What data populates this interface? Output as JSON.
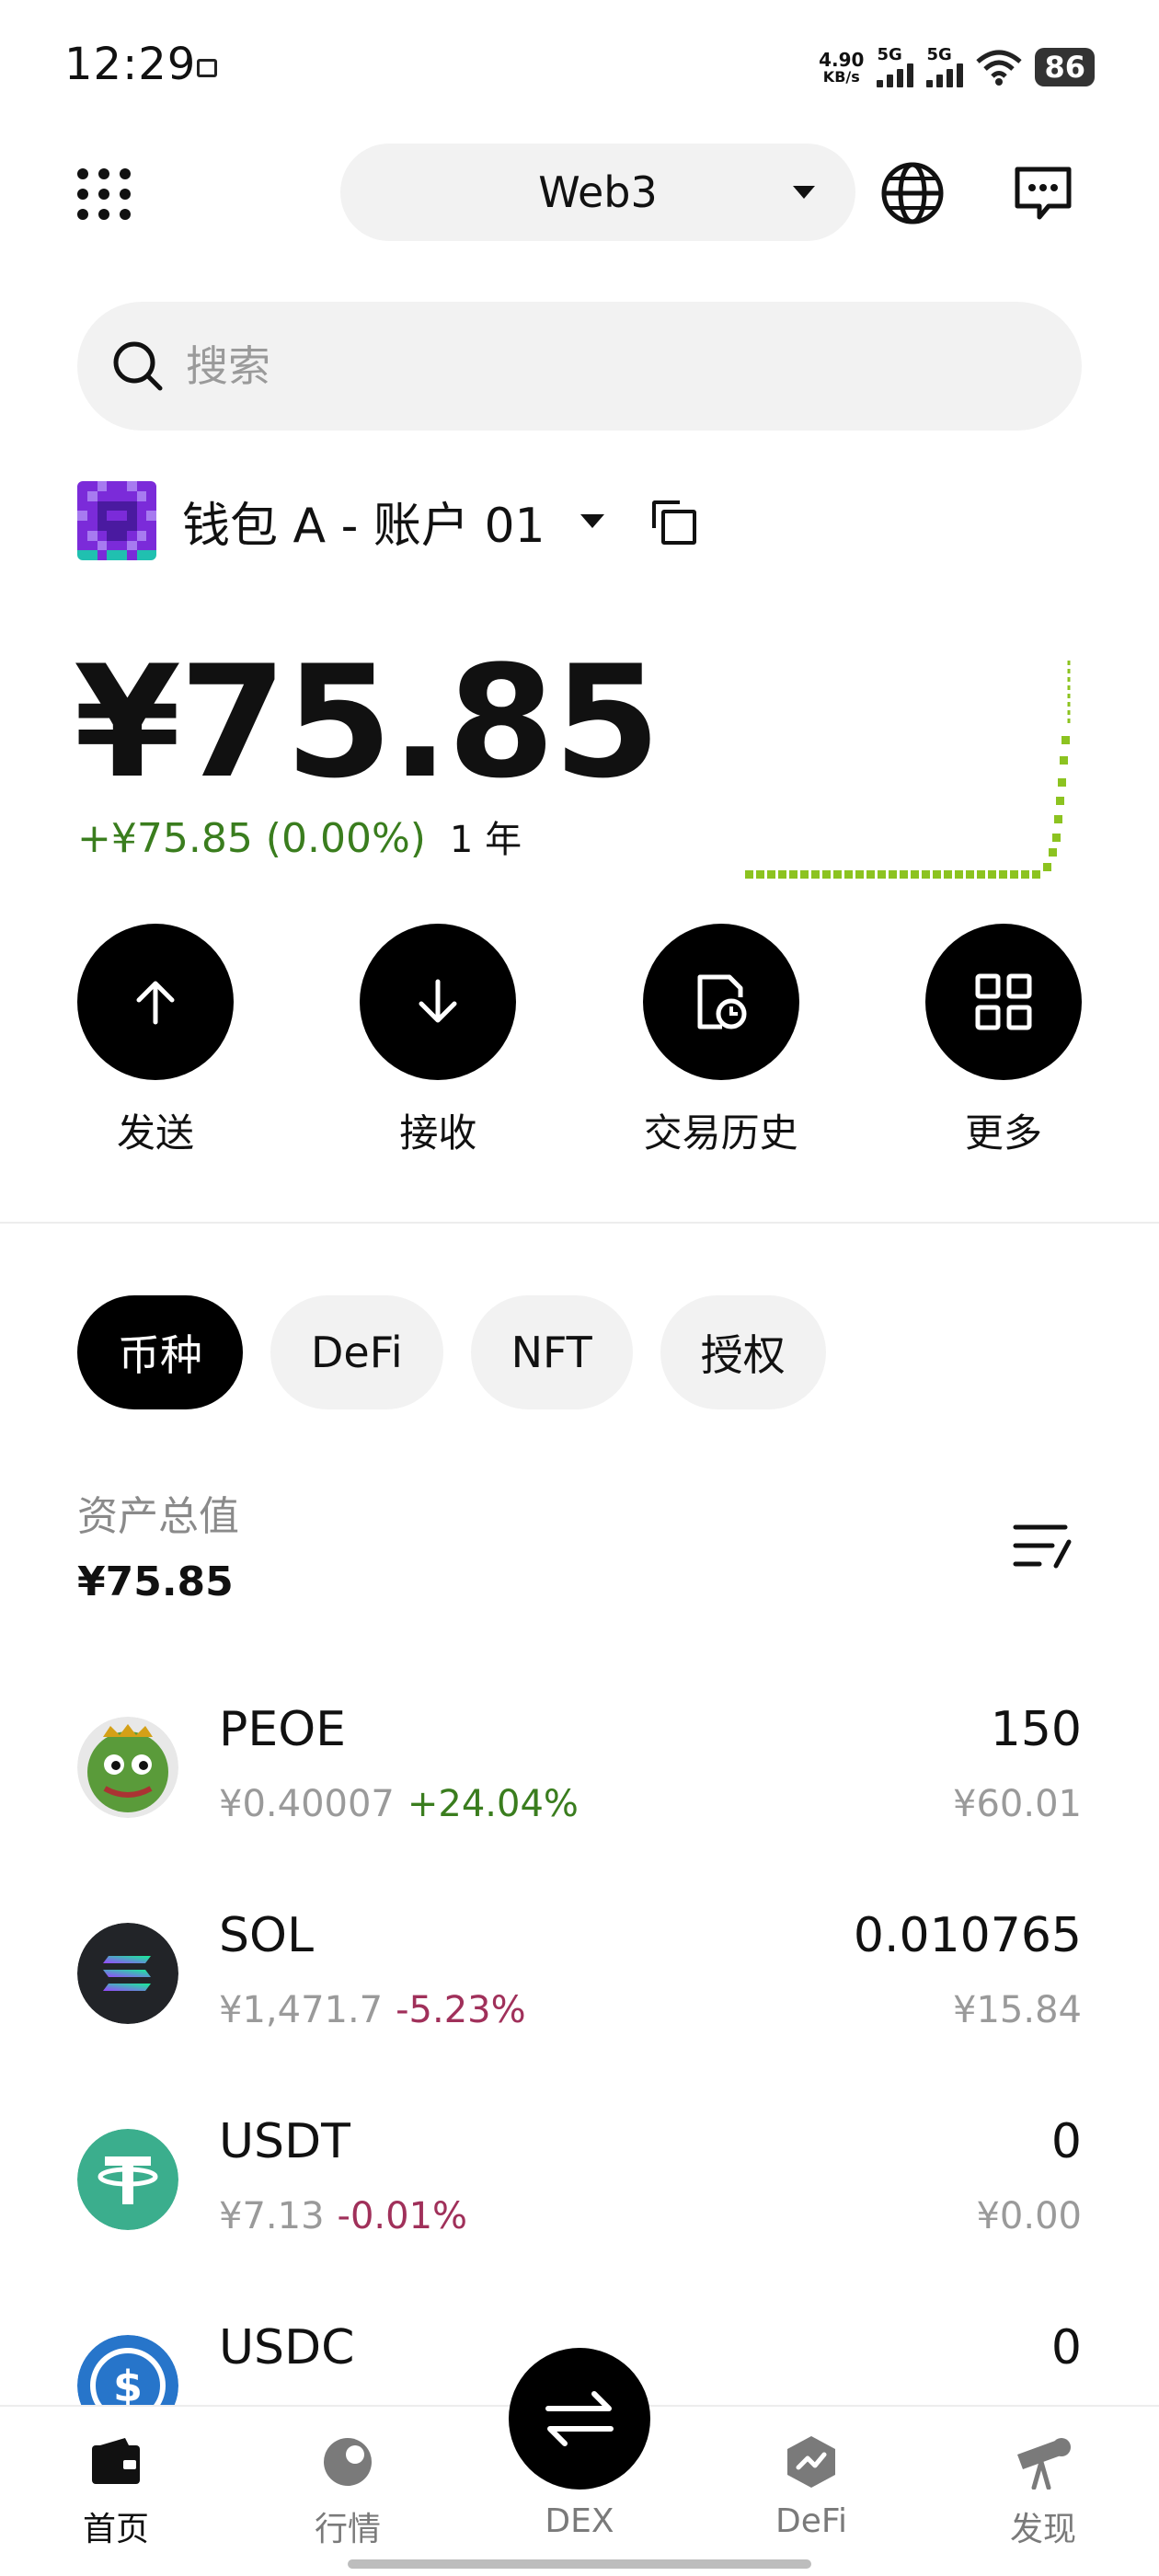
{
  "status_bar": {
    "time": "12:29",
    "net_speed_value": "4.90",
    "net_speed_unit": "KB/s",
    "sim1": "5G",
    "sim2": "5G",
    "battery": "86"
  },
  "header": {
    "network": "Web3",
    "icons": [
      "grid-menu-icon",
      "globe-icon",
      "message-icon"
    ]
  },
  "search": {
    "placeholder": "搜索",
    "value": ""
  },
  "account": {
    "name": "钱包 A - 账户 01"
  },
  "balance": {
    "amount": "¥75.85",
    "change": "+¥75.85 (0.00%)",
    "period": "1 年",
    "colors": {
      "positive": "#3a7d1e",
      "sparkline": "#8cc320"
    }
  },
  "actions": [
    {
      "label": "发送",
      "icon": "arrow-up-icon"
    },
    {
      "label": "接收",
      "icon": "arrow-down-icon"
    },
    {
      "label": "交易历史",
      "icon": "history-icon"
    },
    {
      "label": "更多",
      "icon": "more-grid-icon"
    }
  ],
  "chips": [
    {
      "label": "币种",
      "active": true
    },
    {
      "label": "DeFi",
      "active": false
    },
    {
      "label": "NFT",
      "active": false
    },
    {
      "label": "授权",
      "active": false
    }
  ],
  "assets": {
    "title": "资产总值",
    "total": "¥75.85"
  },
  "tokens": [
    {
      "symbol": "PEOE",
      "price": "¥0.40007",
      "change": "+24.04%",
      "direction": "up",
      "amount": "150",
      "value": "¥60.01",
      "icon": "pepe-logo"
    },
    {
      "symbol": "SOL",
      "price": "¥1,471.7",
      "change": "-5.23%",
      "direction": "down",
      "amount": "0.010765",
      "value": "¥15.84",
      "icon": "solana-logo"
    },
    {
      "symbol": "USDT",
      "price": "¥7.13",
      "change": "-0.01%",
      "direction": "down",
      "amount": "0",
      "value": "¥0.00",
      "icon": "tether-logo"
    },
    {
      "symbol": "USDC",
      "price": "",
      "change": "",
      "direction": "",
      "amount": "0",
      "value": "",
      "icon": "usdc-logo"
    }
  ],
  "bottom_nav": [
    {
      "label": "首页",
      "icon": "wallet-icon",
      "active": true
    },
    {
      "label": "行情",
      "icon": "market-icon",
      "active": false
    },
    {
      "label": "DEX",
      "icon": "swap-icon",
      "active": false
    },
    {
      "label": "DeFi",
      "icon": "defi-icon",
      "active": false
    },
    {
      "label": "发现",
      "icon": "telescope-icon",
      "active": false
    }
  ]
}
